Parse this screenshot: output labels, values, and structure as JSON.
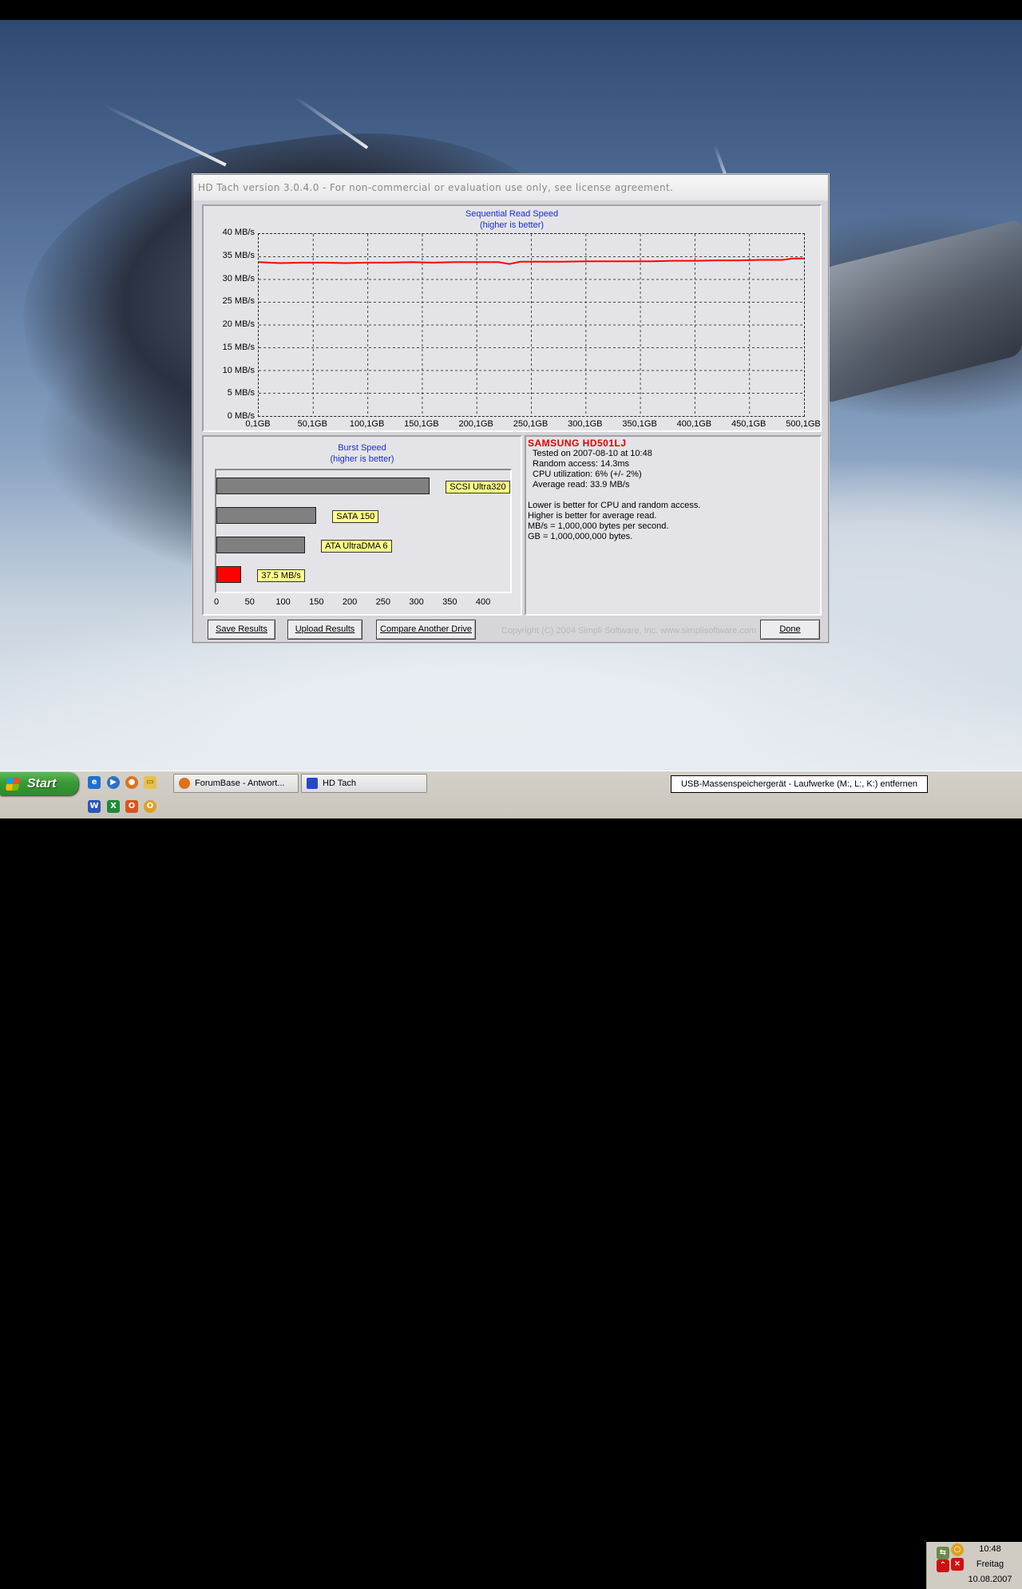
{
  "window": {
    "title": "HD Tach version 3.0.4.0  - For non-commercial or evaluation use only, see license agreement."
  },
  "sequential_chart": {
    "title": "Sequential Read Speed",
    "subtitle": "(higher is better)"
  },
  "burst_chart": {
    "title": "Burst Speed",
    "subtitle": "(higher is better)"
  },
  "chart_data": [
    {
      "type": "line",
      "title": "Sequential Read Speed",
      "subtitle": "(higher is better)",
      "ylabel_ticks": [
        "0 MB/s",
        "5 MB/s",
        "10 MB/s",
        "15 MB/s",
        "20 MB/s",
        "25 MB/s",
        "30 MB/s",
        "35 MB/s",
        "40 MB/s"
      ],
      "xlabel_ticks": [
        "0,1GB",
        "50,1GB",
        "100,1GB",
        "150,1GB",
        "200,1GB",
        "250,1GB",
        "300,1GB",
        "350,1GB",
        "400,1GB",
        "450,1GB",
        "500,1GB"
      ],
      "ylim": [
        0,
        40
      ],
      "xlim": [
        0.1,
        500.1
      ],
      "grid": true,
      "series": [
        {
          "color": "#ff0000",
          "x": [
            0.1,
            20,
            40,
            60,
            80,
            100,
            120,
            140,
            160,
            180,
            200,
            220,
            230,
            240,
            260,
            280,
            300,
            320,
            340,
            360,
            380,
            400,
            420,
            440,
            460,
            480,
            490,
            500.1
          ],
          "y": [
            33.8,
            33.6,
            33.7,
            33.7,
            33.6,
            33.7,
            33.7,
            33.8,
            33.7,
            33.8,
            33.8,
            33.8,
            33.4,
            33.9,
            33.9,
            33.9,
            34.0,
            34.0,
            34.0,
            34.0,
            34.1,
            34.1,
            34.2,
            34.2,
            34.3,
            34.3,
            34.6,
            34.6
          ]
        }
      ]
    },
    {
      "type": "bar",
      "orientation": "horizontal",
      "title": "Burst Speed",
      "subtitle": "(higher is better)",
      "categories": [
        "SCSI Ultra320",
        "SATA 150",
        "ATA UltraDMA 6",
        "37.5 MB/s"
      ],
      "values": [
        320,
        150,
        133,
        37.5
      ],
      "colors": [
        "#808080",
        "#808080",
        "#808080",
        "#ff0000"
      ],
      "xticks": [
        "0",
        "50",
        "100",
        "150",
        "200",
        "250",
        "300",
        "350",
        "400"
      ],
      "xlim": [
        0,
        440
      ]
    }
  ],
  "info": {
    "drive": "SAMSUNG HD501LJ",
    "tested": "Tested on 2007-08-10 at 10:48",
    "random_access": "Random access: 14.3ms",
    "cpu": "CPU utilization: 6% (+/- 2%)",
    "average_read": "Average read: 33.9 MB/s",
    "note1": "Lower is better for CPU and random access.",
    "note2": "Higher is better for average read.",
    "note3": "MB/s = 1,000,000 bytes per second.",
    "note4": "GB = 1,000,000,000 bytes."
  },
  "buttons": {
    "save": "Save Results",
    "upload": "Upload Results",
    "compare": "Compare Another Drive",
    "done": "Done"
  },
  "copyright": "Copyright (C) 2004 Simpli Software, Inc. www.simplisoftware.com",
  "taskbar": {
    "start": "Start",
    "tasks": [
      "ForumBase - Antwort...",
      "HD Tach"
    ],
    "tooltip": "USB-Massenspeichergerät - Laufwerke (M:, L:, K:) entfernen",
    "time": "10:48",
    "day": "Freitag",
    "date": "10.08.2007",
    "quicklaunch_icons": [
      "ie-icon",
      "media-player-icon",
      "firefox-icon",
      "folder-icon",
      "word-icon",
      "excel-icon",
      "office-icon",
      "opera-icon"
    ]
  }
}
